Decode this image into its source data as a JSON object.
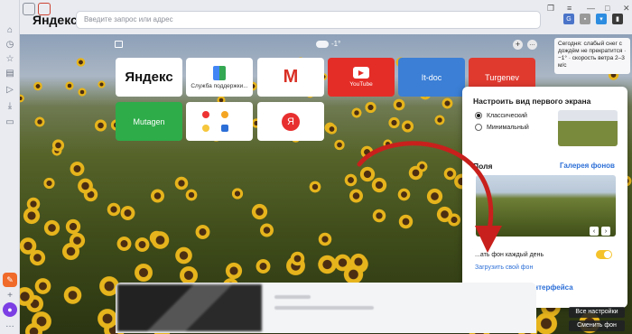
{
  "browser": {
    "brand": "Яндекс",
    "address_placeholder": "Введите запрос или адрес"
  },
  "weather": {
    "temp": "-1°",
    "note": "Сегодня: слабый снег с дождём не прекратится · −1° · скорость ветра 2–3 м/с"
  },
  "tiles": [
    {
      "name": "yandex",
      "label": "Яндекс",
      "caption": "",
      "bg": "#ffffff",
      "fg": "#111111"
    },
    {
      "name": "support",
      "label": "",
      "caption": "Служба поддержки...",
      "bg": "#ffffff",
      "fg": "#333333"
    },
    {
      "name": "gmail",
      "label": "M",
      "caption": "",
      "bg": "#ffffff",
      "fg": "#d93025"
    },
    {
      "name": "youtube",
      "label": "",
      "caption": "YouTube",
      "bg": "#e52d27",
      "fg": "#ffffff"
    },
    {
      "name": "it-doc",
      "label": "It-doc",
      "caption": "",
      "bg": "#3b7fd6",
      "fg": "#ffffff"
    },
    {
      "name": "turgenev",
      "label": "Turgenev",
      "caption": "",
      "bg": "#e03a2f",
      "fg": "#ffffff"
    },
    {
      "name": "mutagen",
      "label": "Mutagen",
      "caption": "",
      "bg": "#2eac4a",
      "fg": "#ffffff"
    },
    {
      "name": "group",
      "label": "",
      "caption": "",
      "bg": "#ffffff",
      "fg": "#333333"
    },
    {
      "name": "yandex-app",
      "label": "Я",
      "caption": "",
      "bg": "#ffffff",
      "fg": "#ffffff"
    }
  ],
  "panel": {
    "title": "Настроить вид первого экрана",
    "options": [
      "Классический",
      "Минимальный"
    ],
    "selected": "Классический",
    "section": "Поля",
    "gallery": "Галерея фонов",
    "daily_toggle": "...ать фон каждый день",
    "upload": "Загрузить свой фон",
    "all_settings": "Все настройки интерфейса"
  },
  "bottom_buttons": [
    "Все настройки",
    "Сменить фон"
  ],
  "colors": {
    "accent": "#2c6fd7",
    "toggle": "#f4c22b",
    "arrow": "#c8201c"
  }
}
